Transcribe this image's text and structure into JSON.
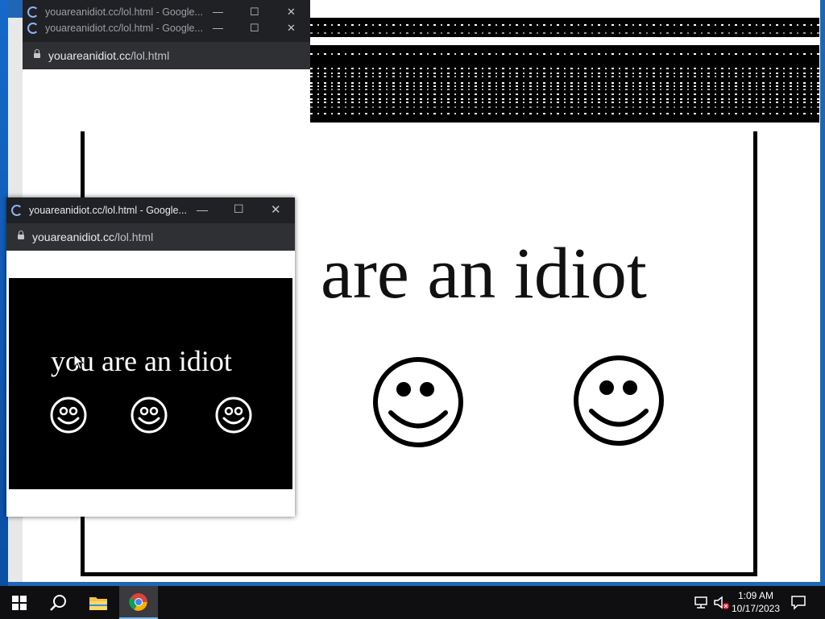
{
  "windows": {
    "back_1": {
      "title": "youareanidiot.cc/lol.html - Google..."
    },
    "back_2": {
      "title": "youareanidiot.cc/lol.html - Google..."
    },
    "front": {
      "title": "youareanidiot.cc/lol.html - Google..."
    }
  },
  "address": {
    "host": "youareanidiot.cc",
    "path": "/lol.html"
  },
  "big_page": {
    "text": "are an idiot"
  },
  "small_page": {
    "text": "you are an idiot"
  },
  "window_controls": {
    "minimize": "—",
    "maximize": "☐",
    "close": "✕"
  },
  "taskbar": {
    "time": "1:09 AM",
    "date": "10/17/2023"
  },
  "colors": {
    "chrome_dark": "#202124",
    "taskbar": "#0f0f12",
    "accent": "#76b9ed"
  }
}
